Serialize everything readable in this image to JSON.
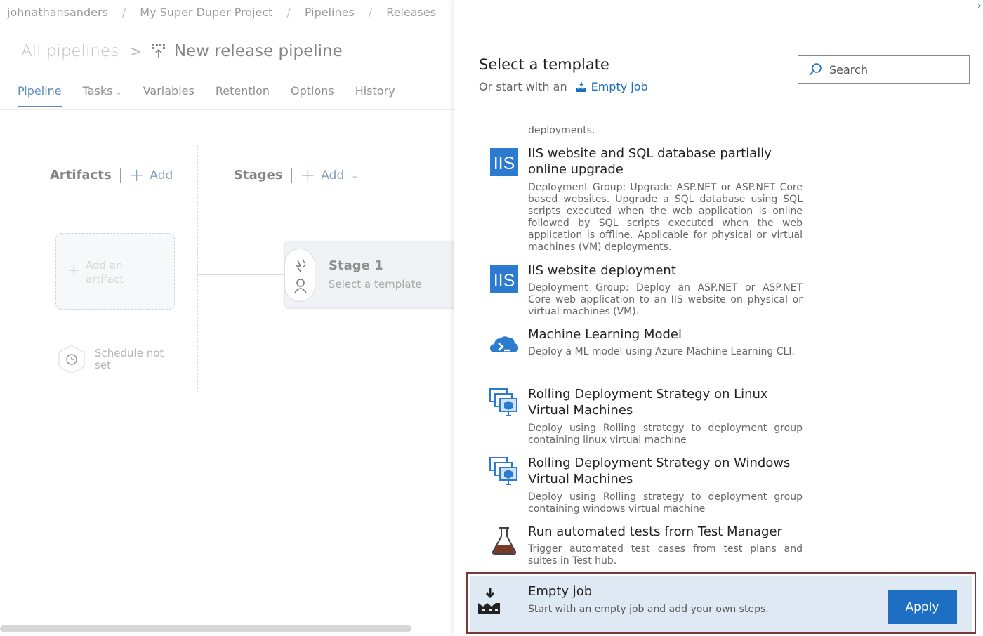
{
  "breadcrumb": [
    "johnathansanders",
    "My Super Duper Project",
    "Pipelines",
    "Releases"
  ],
  "header": {
    "all_pipelines": "All pipelines",
    "title": "New release pipeline"
  },
  "tabs": [
    {
      "label": "Pipeline",
      "active": true
    },
    {
      "label": "Tasks"
    },
    {
      "label": "Variables"
    },
    {
      "label": "Retention"
    },
    {
      "label": "Options"
    },
    {
      "label": "History"
    }
  ],
  "artifacts": {
    "title": "Artifacts",
    "add_label": "Add",
    "placeholder": "Add an artifact",
    "schedule": "Schedule not set"
  },
  "stages": {
    "title": "Stages",
    "add_label": "Add",
    "stage_name": "Stage 1",
    "stage_sub": "Select a template"
  },
  "panel": {
    "title": "Select a template",
    "or_start": "Or start with an",
    "empty_link": "Empty job",
    "search_placeholder": "Search",
    "fragment": "deployments.",
    "templates": [
      {
        "icon": "iis-icon",
        "name": "IIS website and SQL database partially online upgrade",
        "desc": "Deployment Group: Upgrade ASP.NET or ASP.NET Core based websites. Upgrade a SQL database using SQL scripts executed when the web application is online followed by SQL scripts executed when the web application is offline. Applicable for physical or virtual machines (VM) deployments."
      },
      {
        "icon": "iis-icon",
        "name": "IIS website deployment",
        "desc": "Deployment Group: Deploy an ASP.NET or ASP.NET Core web application to an IIS website on physical or virtual machines (VM)."
      },
      {
        "icon": "azure-ml-icon",
        "name": "Machine Learning Model",
        "desc": "Deploy a ML model using Azure Machine Learning CLI."
      },
      {
        "icon": "vm-group-icon",
        "name": "Rolling Deployment Strategy on Linux Virtual Machines",
        "desc": "Deploy using Rolling strategy to deployment group containing linux virtual machine"
      },
      {
        "icon": "vm-group-icon",
        "name": "Rolling Deployment Strategy on Windows Virtual Machines",
        "desc": "Deploy using Rolling strategy to deployment group containing windows virtual machine"
      },
      {
        "icon": "flask-icon",
        "name": "Run automated tests from Test Manager",
        "desc": "Trigger automated test cases from test plans and suites in Test hub."
      }
    ],
    "selected": {
      "icon": "empty-job-icon",
      "name": "Empty job",
      "desc": "Start with an empty job and add your own steps.",
      "apply_label": "Apply"
    }
  },
  "colors": {
    "accent": "#1e6fc4",
    "selected_bg": "#dfe9f4",
    "selected_outline": "#7a3a3a"
  }
}
